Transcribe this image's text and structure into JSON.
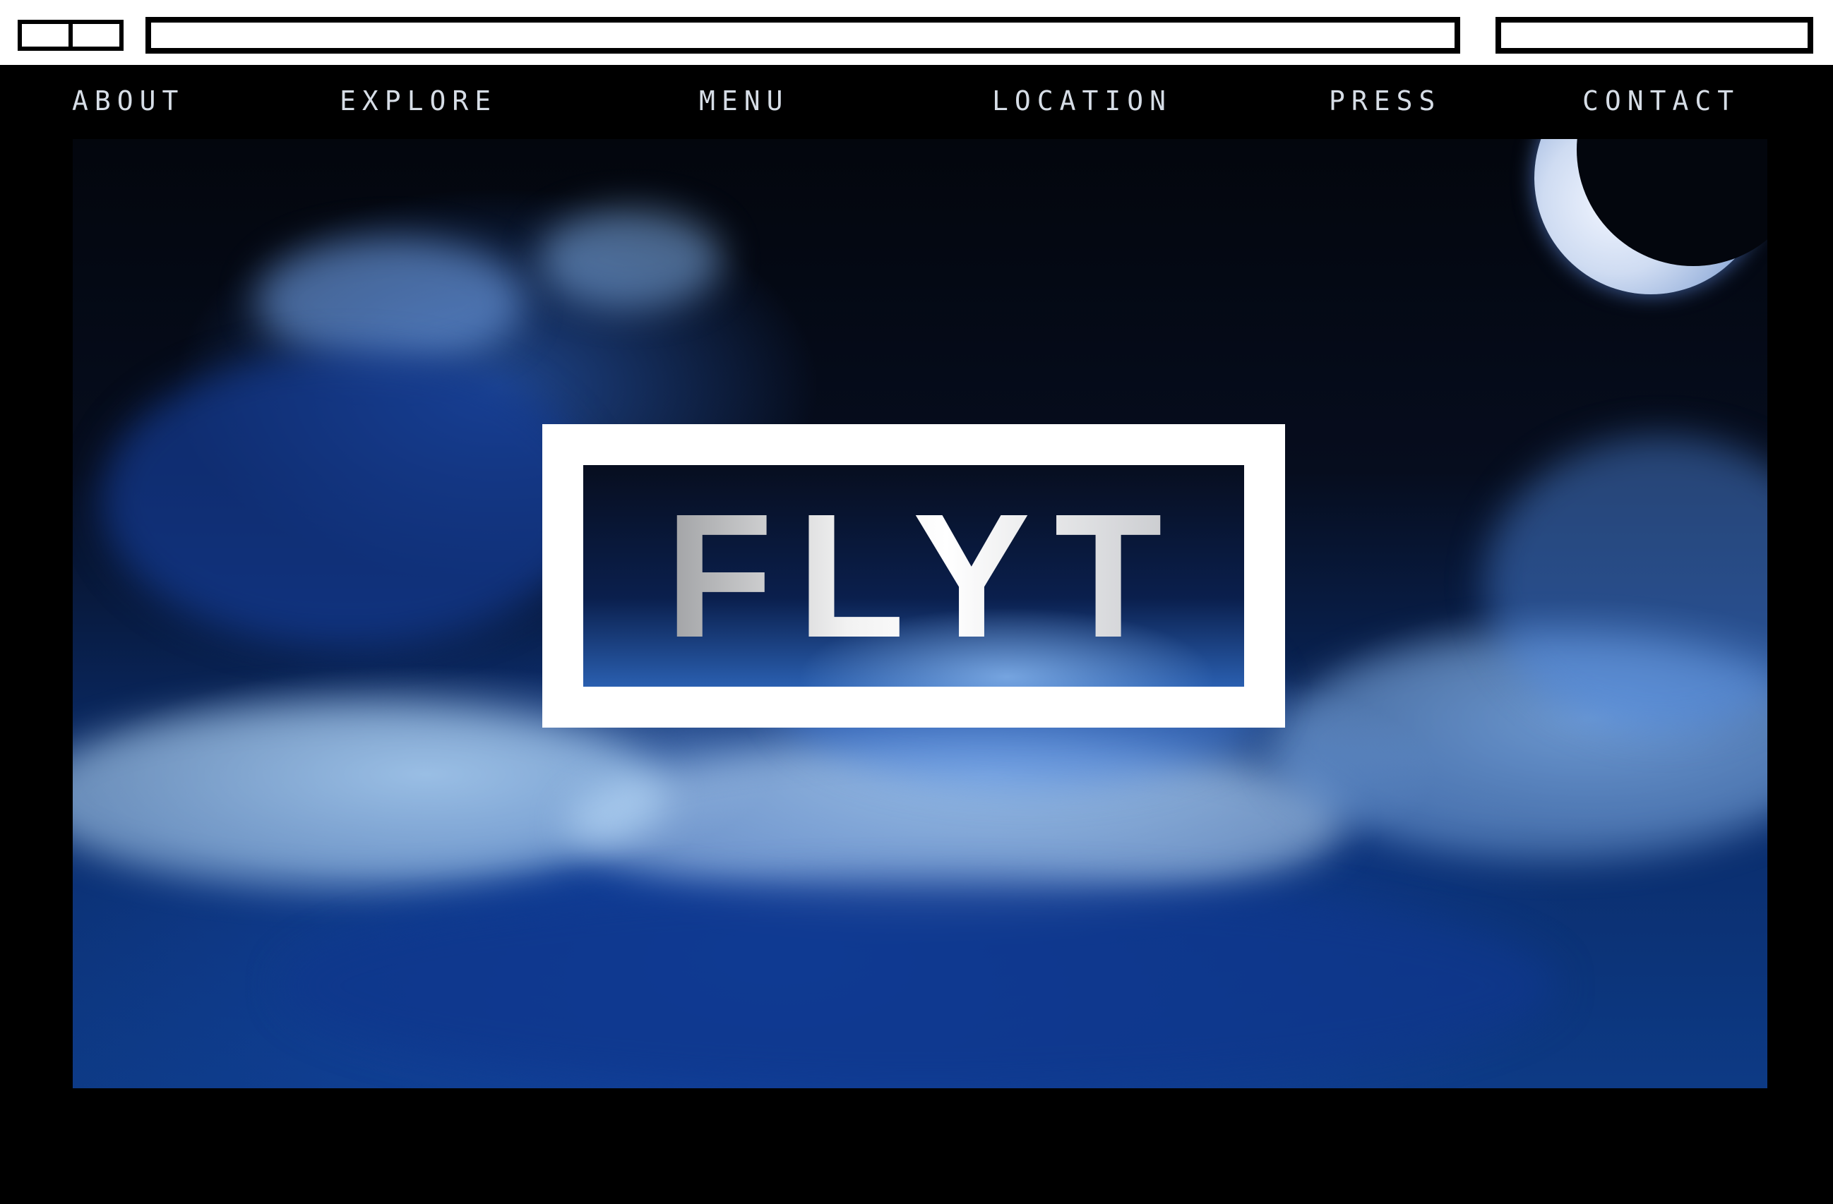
{
  "nav": {
    "items": [
      {
        "label": "ABOUT"
      },
      {
        "label": "EXPLORE"
      },
      {
        "label": "MENU"
      },
      {
        "label": "LOCATION"
      },
      {
        "label": "PRESS"
      },
      {
        "label": "CONTACT"
      }
    ]
  },
  "hero": {
    "logo_text": "FLYT",
    "image": "night-sky-clouds-with-crescent-moon"
  },
  "colors": {
    "background": "#000000",
    "nav_text": "#d6dde6",
    "logo_frame": "#ffffff",
    "sky_blue": "#0d3a85"
  }
}
